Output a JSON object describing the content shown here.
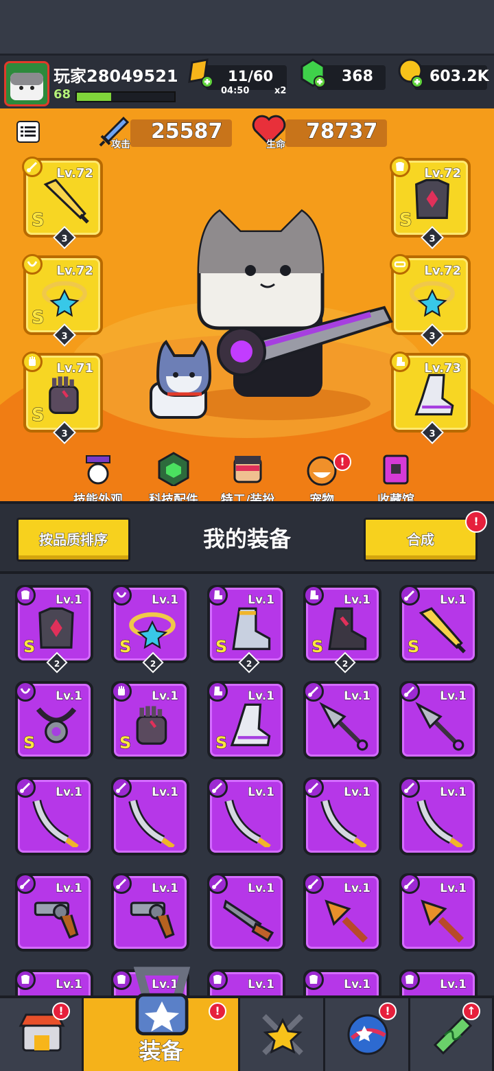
{
  "player": {
    "name": "玩家28049521",
    "level": "68",
    "xp_fraction": 0.35
  },
  "resources": {
    "energy": {
      "value": "11/60",
      "timer": "04:50",
      "multiplier": "x2",
      "icon": "energy-ticket-icon"
    },
    "gems": {
      "value": "368",
      "icon": "green-gem-icon"
    },
    "coins": {
      "value": "603.2K",
      "icon": "gold-coin-icon"
    }
  },
  "stats": {
    "attack": {
      "label": "攻击",
      "value": "25587"
    },
    "hp": {
      "label": "生命",
      "value": "78737"
    }
  },
  "equipped": [
    {
      "slot": "weapon",
      "level": "Lv.72",
      "rank": "S",
      "stars": "3"
    },
    {
      "slot": "necklace",
      "level": "Lv.72",
      "rank": "S",
      "stars": "3"
    },
    {
      "slot": "gloves",
      "level": "Lv.71",
      "rank": "S",
      "stars": "3"
    },
    {
      "slot": "armor",
      "level": "Lv.72",
      "rank": "S",
      "stars": "3"
    },
    {
      "slot": "belt",
      "level": "Lv.72",
      "rank": "",
      "stars": "3"
    },
    {
      "slot": "boots",
      "level": "Lv.73",
      "rank": "",
      "stars": "3"
    }
  ],
  "features": [
    {
      "label": "技能外观",
      "badge": ""
    },
    {
      "label": "科技配件",
      "badge": ""
    },
    {
      "label": "特工/装扮",
      "badge": ""
    },
    {
      "label": "宠物",
      "badge": "!"
    },
    {
      "label": "收藏馆",
      "badge": ""
    }
  ],
  "equipment_panel": {
    "sort_button": "按品质排序",
    "title": "我的装备",
    "merge_button": "合成",
    "merge_badge": "!"
  },
  "inventory": [
    {
      "type": "armor",
      "level": "Lv.1",
      "rank": "S",
      "stars": "2",
      "art": "armor"
    },
    {
      "type": "necklace",
      "level": "Lv.1",
      "rank": "S",
      "stars": "2",
      "art": "ring"
    },
    {
      "type": "boots",
      "level": "Lv.1",
      "rank": "S",
      "stars": "2",
      "art": "boot"
    },
    {
      "type": "boots",
      "level": "Lv.1",
      "rank": "S",
      "stars": "2",
      "art": "boot-dark"
    },
    {
      "type": "weapon",
      "level": "Lv.1",
      "rank": "S",
      "stars": "",
      "art": "sword"
    },
    {
      "type": "necklace",
      "level": "Lv.1",
      "rank": "S",
      "stars": "",
      "art": "amulet"
    },
    {
      "type": "gloves",
      "level": "Lv.1",
      "rank": "S",
      "stars": "",
      "art": "glove"
    },
    {
      "type": "boots",
      "level": "Lv.1",
      "rank": "S",
      "stars": "",
      "art": "boot-silver"
    },
    {
      "type": "weapon",
      "level": "Lv.1",
      "rank": "",
      "stars": "",
      "art": "kunai"
    },
    {
      "type": "weapon",
      "level": "Lv.1",
      "rank": "",
      "stars": "",
      "art": "kunai"
    },
    {
      "type": "weapon",
      "level": "Lv.1",
      "rank": "",
      "stars": "",
      "art": "katana"
    },
    {
      "type": "weapon",
      "level": "Lv.1",
      "rank": "",
      "stars": "",
      "art": "katana"
    },
    {
      "type": "weapon",
      "level": "Lv.1",
      "rank": "",
      "stars": "",
      "art": "katana"
    },
    {
      "type": "weapon",
      "level": "Lv.1",
      "rank": "",
      "stars": "",
      "art": "katana"
    },
    {
      "type": "weapon",
      "level": "Lv.1",
      "rank": "",
      "stars": "",
      "art": "katana"
    },
    {
      "type": "weapon",
      "level": "Lv.1",
      "rank": "",
      "stars": "",
      "art": "revolver"
    },
    {
      "type": "weapon",
      "level": "Lv.1",
      "rank": "",
      "stars": "",
      "art": "revolver"
    },
    {
      "type": "weapon",
      "level": "Lv.1",
      "rank": "",
      "stars": "",
      "art": "shotgun"
    },
    {
      "type": "weapon",
      "level": "Lv.1",
      "rank": "",
      "stars": "",
      "art": "drill"
    },
    {
      "type": "weapon",
      "level": "Lv.1",
      "rank": "",
      "stars": "",
      "art": "drill"
    },
    {
      "type": "armor",
      "level": "Lv.1",
      "rank": "",
      "stars": "",
      "art": ""
    },
    {
      "type": "armor",
      "level": "Lv.1",
      "rank": "",
      "stars": "",
      "art": ""
    },
    {
      "type": "armor",
      "level": "Lv.1",
      "rank": "",
      "stars": "",
      "art": ""
    },
    {
      "type": "armor",
      "level": "Lv.1",
      "rank": "",
      "stars": "",
      "art": ""
    },
    {
      "type": "armor",
      "level": "Lv.1",
      "rank": "",
      "stars": "",
      "art": ""
    }
  ],
  "bottom_nav": [
    {
      "name": "shop",
      "label": "",
      "badge": "!",
      "icon": "shop-icon"
    },
    {
      "name": "equipment",
      "label": "装备",
      "badge": "!",
      "icon": "equipment-bag-icon",
      "active": true
    },
    {
      "name": "battle",
      "label": "",
      "badge": "",
      "icon": "crossed-swords-star-icon"
    },
    {
      "name": "gacha",
      "label": "",
      "badge": "!",
      "icon": "star-orb-icon"
    },
    {
      "name": "evolve",
      "label": "",
      "badge": "↑",
      "icon": "dna-capsule-icon"
    }
  ],
  "colors": {
    "hero_bg": "#f59c1a",
    "legendary_slot": "#f7d623",
    "epic_cell": "#b637e8",
    "badge": "#e6203c"
  }
}
